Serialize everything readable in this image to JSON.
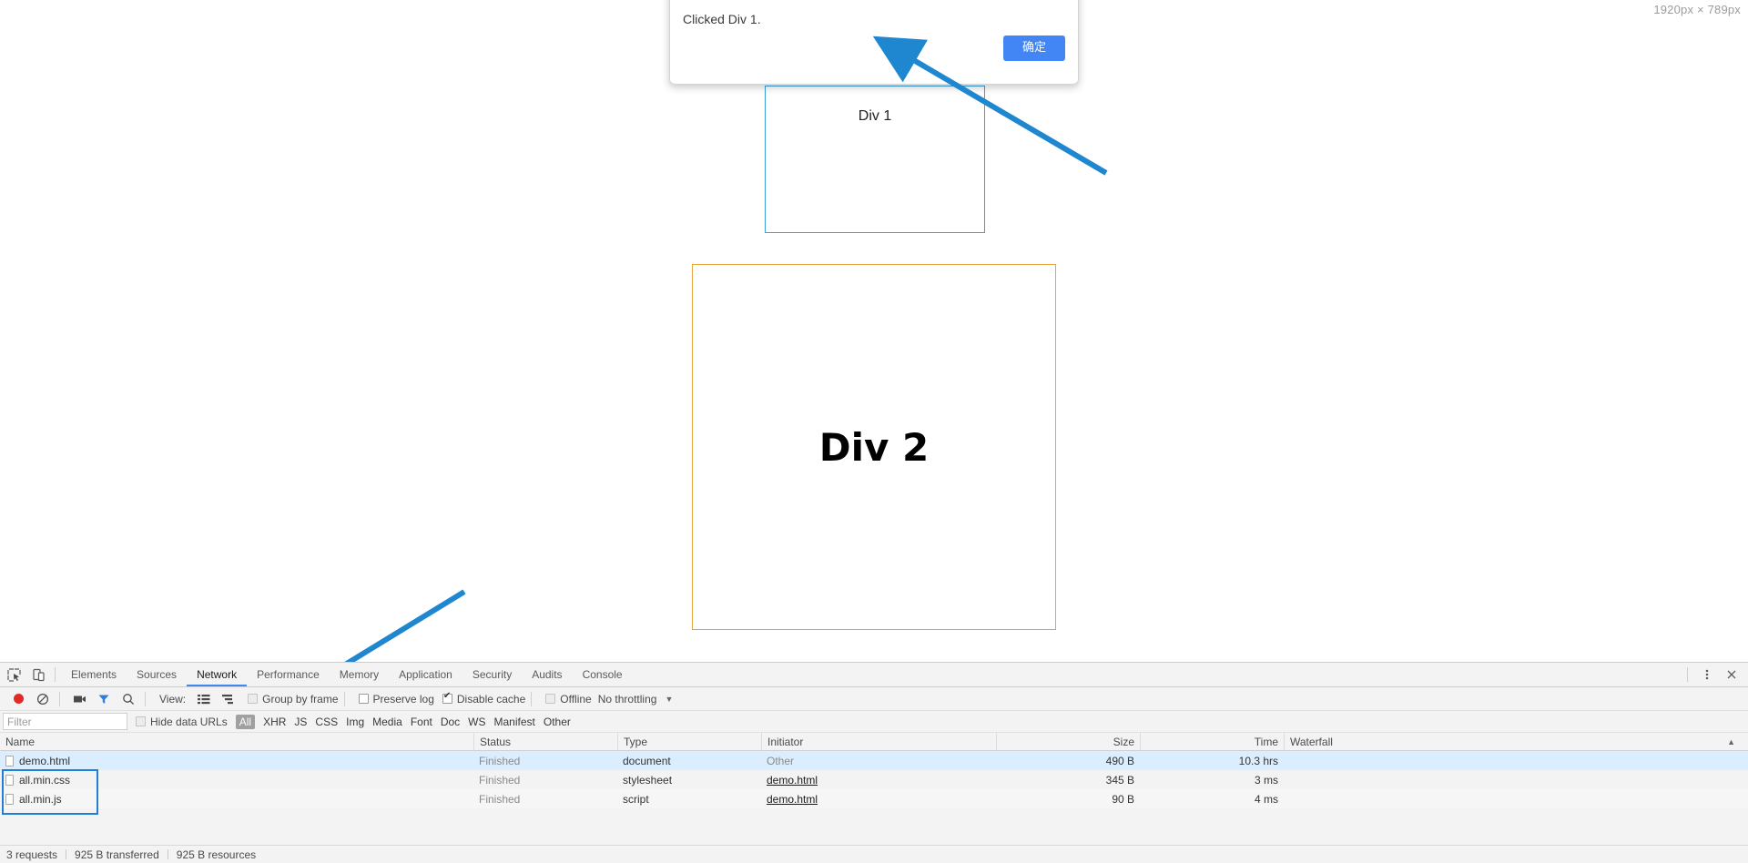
{
  "viewport": {
    "dimension_badge": "1920px × 789px"
  },
  "alert": {
    "message": "Clicked Div 1.",
    "ok_label": "确定"
  },
  "boxes": {
    "div1_label": "Div 1",
    "div1_border_color": "#3aa0e0",
    "div2_label": "Div 2",
    "div2_border_color": "#e8a33d"
  },
  "devtools": {
    "tabs": [
      {
        "label": "Elements",
        "active": false
      },
      {
        "label": "Sources",
        "active": false
      },
      {
        "label": "Network",
        "active": true
      },
      {
        "label": "Performance",
        "active": false
      },
      {
        "label": "Memory",
        "active": false
      },
      {
        "label": "Application",
        "active": false
      },
      {
        "label": "Security",
        "active": false
      },
      {
        "label": "Audits",
        "active": false
      },
      {
        "label": "Console",
        "active": false
      }
    ],
    "toolbar": {
      "view_label": "View:",
      "group_by_frame": "Group by frame",
      "preserve_log": "Preserve log",
      "disable_cache": "Disable cache",
      "offline": "Offline",
      "throttling": "No throttling"
    },
    "filter": {
      "placeholder": "Filter",
      "hide_data_urls": "Hide data URLs",
      "types": [
        "All",
        "XHR",
        "JS",
        "CSS",
        "Img",
        "Media",
        "Font",
        "Doc",
        "WS",
        "Manifest",
        "Other"
      ],
      "selected_type": "All"
    },
    "columns": [
      "Name",
      "Status",
      "Type",
      "Initiator",
      "Size",
      "Time",
      "Waterfall"
    ],
    "rows": [
      {
        "name": "demo.html",
        "status": "Finished",
        "type": "document",
        "initiator": "Other",
        "initiator_is_link": false,
        "size": "490 B",
        "time": "10.3 hrs",
        "selected": true
      },
      {
        "name": "all.min.css",
        "status": "Finished",
        "type": "stylesheet",
        "initiator": "demo.html",
        "initiator_is_link": true,
        "size": "345 B",
        "time": "3 ms",
        "selected": false
      },
      {
        "name": "all.min.js",
        "status": "Finished",
        "type": "script",
        "initiator": "demo.html",
        "initiator_is_link": true,
        "size": "90 B",
        "time": "4 ms",
        "selected": false
      }
    ],
    "status_bar": {
      "requests": "3 requests",
      "transferred": "925 B transferred",
      "resources": "925 B resources"
    }
  },
  "colors": {
    "accent": "#4285f4",
    "selection": "#dbeeff",
    "annotation": "#1f86d0"
  }
}
